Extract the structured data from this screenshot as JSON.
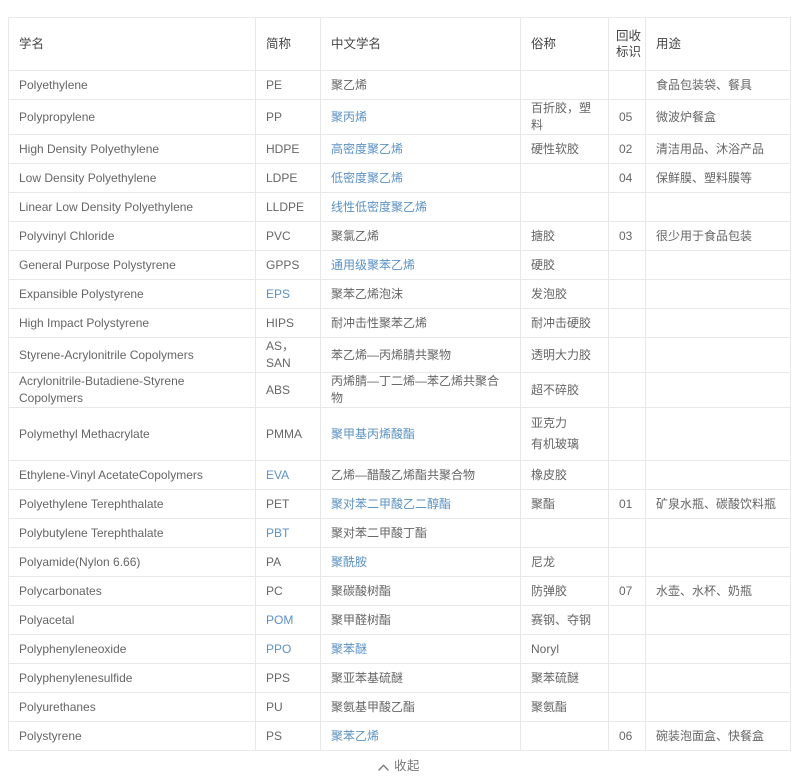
{
  "table": {
    "headers": [
      {
        "label": "学名",
        "key": "scientific"
      },
      {
        "label": "简称",
        "key": "abbr"
      },
      {
        "label": "中文学名",
        "key": "chinese"
      },
      {
        "label": "俗称",
        "key": "alias"
      },
      {
        "label_line1": "回收",
        "label_line2": "标识",
        "key": "recycle"
      },
      {
        "label": "用途",
        "key": "use"
      }
    ],
    "rows": [
      {
        "scientific": "Polyethylene",
        "abbr": "PE",
        "abbr_link": false,
        "chinese": "聚乙烯",
        "chinese_link": false,
        "alias": "",
        "recycle": "",
        "use": "食品包装袋、餐具"
      },
      {
        "scientific": "Polypropylene",
        "abbr": "PP",
        "abbr_link": false,
        "chinese": "聚丙烯",
        "chinese_link": true,
        "alias": "百折胶，塑料",
        "recycle": "05",
        "use": "微波炉餐盒"
      },
      {
        "scientific": "High Density Polyethylene",
        "abbr": "HDPE",
        "abbr_link": false,
        "chinese": "高密度聚乙烯",
        "chinese_link": true,
        "alias": "硬性软胶",
        "recycle": "02",
        "use": "清洁用品、沐浴产品"
      },
      {
        "scientific": "Low Density Polyethylene",
        "abbr": "LDPE",
        "abbr_link": false,
        "chinese": "低密度聚乙烯",
        "chinese_link": true,
        "alias": "",
        "recycle": "04",
        "use": "保鲜膜、塑料膜等"
      },
      {
        "scientific": "Linear Low Density Polyethylene",
        "abbr": "LLDPE",
        "abbr_link": false,
        "chinese": "线性低密度聚乙烯",
        "chinese_link": true,
        "alias": "",
        "recycle": "",
        "use": ""
      },
      {
        "scientific": "Polyvinyl Chloride",
        "abbr": "PVC",
        "abbr_link": false,
        "chinese": "聚氯乙烯",
        "chinese_link": false,
        "alias": "搪胶",
        "recycle": "03",
        "use": "很少用于食品包装"
      },
      {
        "scientific": "General Purpose Polystyrene",
        "abbr": "GPPS",
        "abbr_link": false,
        "chinese": "通用级聚苯乙烯",
        "chinese_link": true,
        "alias": "硬胶",
        "recycle": "",
        "use": ""
      },
      {
        "scientific": "Expansible Polystyrene",
        "abbr": "EPS",
        "abbr_link": true,
        "chinese": "聚苯乙烯泡沫",
        "chinese_link": false,
        "alias": "发泡胶",
        "recycle": "",
        "use": ""
      },
      {
        "scientific": "High Impact Polystyrene",
        "abbr": "HIPS",
        "abbr_link": false,
        "chinese": "耐冲击性聚苯乙烯",
        "chinese_link": false,
        "alias": "耐冲击硬胶",
        "recycle": "",
        "use": ""
      },
      {
        "scientific": "Styrene-Acrylonitrile Copolymers",
        "abbr": "AS，SAN",
        "abbr_link": false,
        "chinese": "苯乙烯—丙烯腈共聚物",
        "chinese_link": false,
        "alias": "透明大力胶",
        "recycle": "",
        "use": ""
      },
      {
        "scientific": "Acrylonitrile-Butadiene-Styrene Copolymers",
        "abbr": "ABS",
        "abbr_link": false,
        "chinese": "丙烯腈—丁二烯—苯乙烯共聚合物",
        "chinese_link": false,
        "alias": "超不碎胶",
        "recycle": "",
        "use": ""
      },
      {
        "scientific": "Polymethyl Methacrylate",
        "abbr": "PMMA",
        "abbr_link": false,
        "chinese": "聚甲基丙烯酸酯",
        "chinese_link": true,
        "alias_lines": [
          "亚克力",
          "有机玻璃"
        ],
        "recycle": "",
        "use": "",
        "tall": true
      },
      {
        "scientific": "Ethylene-Vinyl AcetateCopolymers",
        "abbr": "EVA",
        "abbr_link": true,
        "chinese": "乙烯—醋酸乙烯酯共聚合物",
        "chinese_link": false,
        "alias": "橡皮胶",
        "recycle": "",
        "use": ""
      },
      {
        "scientific": "Polyethylene Terephthalate",
        "abbr": "PET",
        "abbr_link": false,
        "chinese": "聚对苯二甲酸乙二醇酯",
        "chinese_link": true,
        "alias": "聚酯",
        "recycle": "01",
        "use": "矿泉水瓶、碳酸饮料瓶"
      },
      {
        "scientific": "Polybutylene Terephthalate",
        "abbr": "PBT",
        "abbr_link": true,
        "chinese": "聚对苯二甲酸丁酯",
        "chinese_link": false,
        "alias": "",
        "recycle": "",
        "use": ""
      },
      {
        "scientific": "Polyamide(Nylon 6.66)",
        "abbr": "PA",
        "abbr_link": false,
        "chinese": "聚酰胺",
        "chinese_link": true,
        "alias": "尼龙",
        "recycle": "",
        "use": ""
      },
      {
        "scientific": "Polycarbonates",
        "abbr": "PC",
        "abbr_link": false,
        "chinese": "聚碳酸树酯",
        "chinese_link": false,
        "alias": "防弹胶",
        "recycle": "07",
        "use": "水壶、水杯、奶瓶"
      },
      {
        "scientific": "Polyacetal",
        "abbr": "POM",
        "abbr_link": true,
        "chinese": "聚甲醛树酯",
        "chinese_link": false,
        "alias": "赛钢、夺钢",
        "recycle": "",
        "use": ""
      },
      {
        "scientific": "Polyphenyleneoxide",
        "abbr": "PPO",
        "abbr_link": true,
        "chinese": "聚苯醚",
        "chinese_link": true,
        "alias": "Noryl",
        "recycle": "",
        "use": ""
      },
      {
        "scientific": "Polyphenylenesulfide",
        "abbr": "PPS",
        "abbr_link": false,
        "chinese": "聚亚苯基硫醚",
        "chinese_link": false,
        "alias": "聚苯硫醚",
        "recycle": "",
        "use": ""
      },
      {
        "scientific": "Polyurethanes",
        "abbr": "PU",
        "abbr_link": false,
        "chinese": "聚氨基甲酸乙酯",
        "chinese_link": false,
        "alias": "聚氨酯",
        "recycle": "",
        "use": ""
      },
      {
        "scientific": "Polystyrene",
        "abbr": "PS",
        "abbr_link": false,
        "chinese": "聚苯乙烯",
        "chinese_link": true,
        "alias": "",
        "recycle": "06",
        "use": "碗装泡面盒、快餐盒"
      }
    ]
  },
  "footer": {
    "collapse_label": "收起",
    "chevron_icon": "chevron-up-icon"
  },
  "colors": {
    "link": "#5b92c4",
    "text": "#666666",
    "header_text": "#444444",
    "border": "#e8e8e8",
    "background": "#ffffff"
  }
}
